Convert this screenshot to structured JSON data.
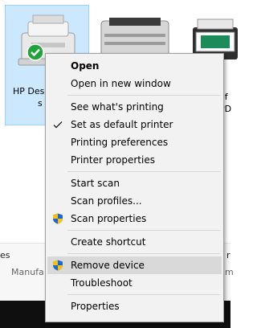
{
  "devices": {
    "printer1_line1": "HP Des",
    "printer1_line2": "s",
    "printer3_line1": "of",
    "printer3_line2": "PD"
  },
  "bottom_pane": {
    "left_text": "es",
    "manufacturer_label": "Manufa",
    "right_text_1": "r",
    "right_text_2": "m"
  },
  "context_menu": {
    "items": [
      {
        "label": "Open"
      },
      {
        "label": "Open in new window"
      },
      {
        "label": "See what's printing"
      },
      {
        "label": "Set as default printer"
      },
      {
        "label": "Printing preferences"
      },
      {
        "label": "Printer properties"
      },
      {
        "label": "Start scan"
      },
      {
        "label": "Scan profiles..."
      },
      {
        "label": "Scan properties"
      },
      {
        "label": "Create shortcut"
      },
      {
        "label": "Remove device"
      },
      {
        "label": "Troubleshoot"
      },
      {
        "label": "Properties"
      }
    ]
  },
  "colors": {
    "selection": "#cce8ff",
    "menu_bg": "#f2f2f2",
    "highlight": "#d9d9d9",
    "taskbar": "#0f0f0f"
  }
}
